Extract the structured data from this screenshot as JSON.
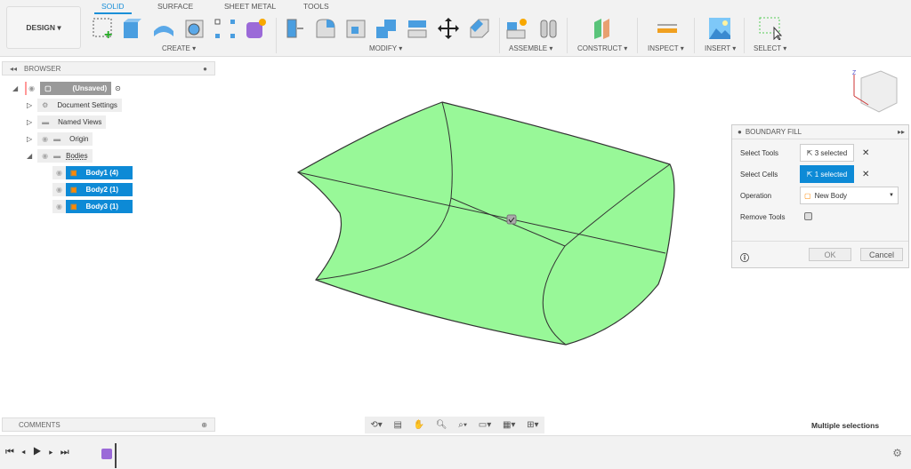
{
  "toolbar": {
    "design": "DESIGN ▾",
    "tabs": [
      "SOLID",
      "SURFACE",
      "SHEET METAL",
      "TOOLS"
    ],
    "groups": [
      "CREATE ▾",
      "MODIFY ▾",
      "ASSEMBLE ▾",
      "CONSTRUCT ▾",
      "INSPECT ▾",
      "INSERT ▾",
      "SELECT ▾"
    ]
  },
  "browser": {
    "title": "BROWSER",
    "root": "(Unsaved)",
    "items": [
      "Document Settings",
      "Named Views",
      "Origin",
      "Bodies"
    ],
    "bodies": [
      "Body1 (4)",
      "Body2 (1)",
      "Body3 (1)"
    ]
  },
  "comments": {
    "title": "COMMENTS"
  },
  "dialog": {
    "title": "BOUNDARY FILL",
    "select_tools_label": "Select Tools",
    "select_tools_value": "3 selected",
    "select_cells_label": "Select Cells",
    "select_cells_value": "1 selected",
    "operation_label": "Operation",
    "operation_value": "New Body",
    "remove_tools_label": "Remove Tools",
    "ok": "OK",
    "cancel": "Cancel"
  },
  "status": "Multiple selections",
  "colors": {
    "accent": "#0d8ad6",
    "body_fill": "#98f898"
  }
}
